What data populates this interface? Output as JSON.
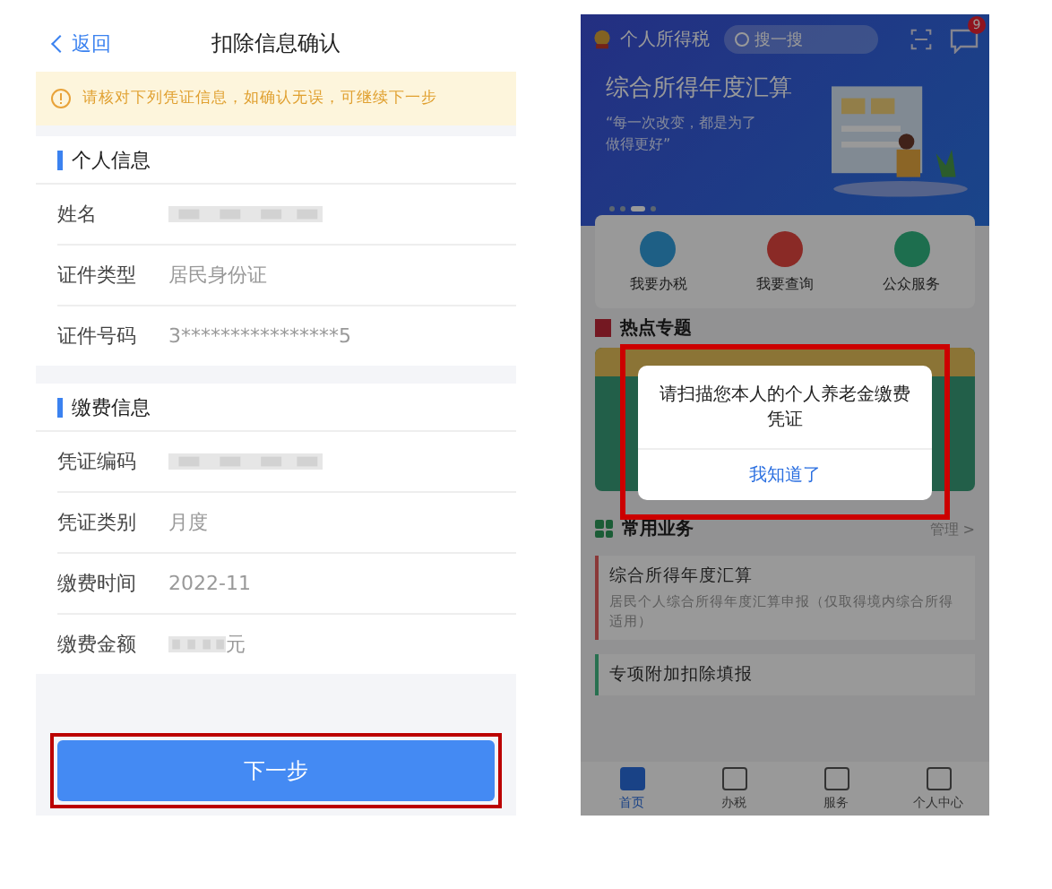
{
  "left_screen": {
    "nav": {
      "back": "返回",
      "title": "扣除信息确认"
    },
    "notice": "请核对下列凭证信息，如确认无误，可继续下一步",
    "sections": [
      {
        "title": "个人信息",
        "rows": [
          {
            "label": "姓名",
            "redacted": true
          },
          {
            "label": "证件类型",
            "value": "居民身份证"
          },
          {
            "label": "证件号码",
            "value": "3****************5"
          }
        ]
      },
      {
        "title": "缴费信息",
        "rows": [
          {
            "label": "凭证编码",
            "redacted": true
          },
          {
            "label": "凭证类别",
            "value": "月度"
          },
          {
            "label": "缴费时间",
            "value": "2022-11"
          },
          {
            "label": "缴费金额",
            "redacted": true,
            "value": "元"
          }
        ]
      }
    ],
    "next_button": "下一步"
  },
  "right_screen": {
    "header": {
      "app_name": "个人所得税",
      "search_placeholder": "搜一搜",
      "badge": "9"
    },
    "banner": {
      "title": "综合所得年度汇算",
      "slogan": "“每一次改变，都是为了做得更好”"
    },
    "quick_actions": [
      {
        "label": "我要办税",
        "color": "#1e5f85"
      },
      {
        "label": "我要查询",
        "color": "#8a2a26"
      },
      {
        "label": "公众服务",
        "color": "#1d6e4e"
      }
    ],
    "hot_topics": {
      "title": "热点专题"
    },
    "dialog": {
      "message": "请扫描您本人的个人养老金缴费凭证",
      "button": "我知道了"
    },
    "common": {
      "title": "常用业务",
      "manage": "管理 >"
    },
    "cards": [
      {
        "title": "综合所得年度汇算",
        "desc": "居民个人综合所得年度汇算申报（仅取得境内综合所得适用）",
        "color": "#8a3838"
      },
      {
        "title": "专项附加扣除填报",
        "color": "#287050"
      }
    ],
    "tabs": [
      {
        "label": "首页",
        "selected": true
      },
      {
        "label": "办税",
        "selected": false
      },
      {
        "label": "服务",
        "selected": false
      },
      {
        "label": "个人中心",
        "selected": false
      }
    ]
  }
}
